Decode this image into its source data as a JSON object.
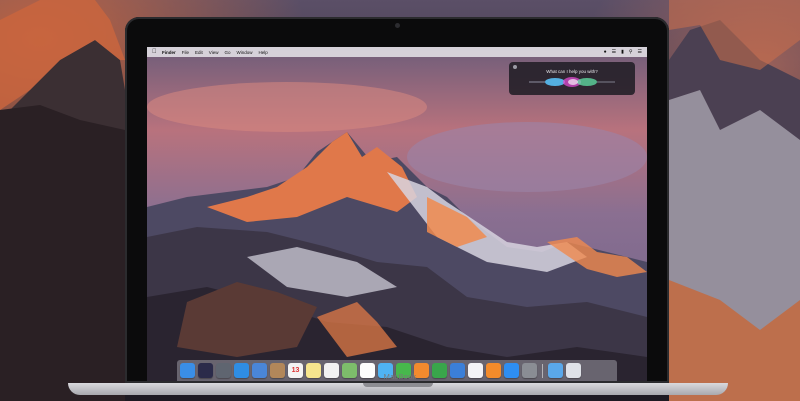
{
  "menubar": {
    "apple_icon": "apple-logo-icon",
    "items": [
      "Finder",
      "File",
      "Edit",
      "View",
      "Go",
      "Window",
      "Help"
    ],
    "status_icons": [
      "siri-icon",
      "wifi-icon",
      "battery-icon",
      "spotlight-icon",
      "notification-center-icon"
    ]
  },
  "siri": {
    "prompt": "What can I help you with?",
    "colors": {
      "blue": "#5bc8ff",
      "magenta": "#e04bd2",
      "green": "#61e3a6"
    }
  },
  "dock": {
    "apps": [
      {
        "name": "Finder",
        "icon": "finder-icon",
        "color": "#3a8ee6"
      },
      {
        "name": "Siri",
        "icon": "siri-icon",
        "color": "#2b2b4a"
      },
      {
        "name": "Launchpad",
        "icon": "launchpad-icon",
        "color": "#5f6570"
      },
      {
        "name": "Safari",
        "icon": "safari-icon",
        "color": "#2f8de4"
      },
      {
        "name": "Mail",
        "icon": "mail-icon",
        "color": "#4a86d8"
      },
      {
        "name": "Contacts",
        "icon": "contacts-icon",
        "color": "#b2875a"
      },
      {
        "name": "Calendar",
        "icon": "calendar-icon",
        "color": "#f4f4f4",
        "text": "13"
      },
      {
        "name": "Notes",
        "icon": "notes-icon",
        "color": "#f6e58d"
      },
      {
        "name": "Reminders",
        "icon": "reminders-icon",
        "color": "#f2f2f2"
      },
      {
        "name": "Maps",
        "icon": "maps-icon",
        "color": "#7dbd6b"
      },
      {
        "name": "Photos",
        "icon": "photos-icon",
        "color": "#fdfdfd"
      },
      {
        "name": "Messages",
        "icon": "messages-icon",
        "color": "#4fb3f2"
      },
      {
        "name": "FaceTime",
        "icon": "facetime-icon",
        "color": "#47b84c"
      },
      {
        "name": "Pages",
        "icon": "pages-icon",
        "color": "#f28a2e"
      },
      {
        "name": "Numbers",
        "icon": "numbers-icon",
        "color": "#39a64b"
      },
      {
        "name": "Keynote",
        "icon": "keynote-icon",
        "color": "#3b7fd8"
      },
      {
        "name": "iTunes",
        "icon": "itunes-icon",
        "color": "#f3f3f6"
      },
      {
        "name": "iBooks",
        "icon": "ibooks-icon",
        "color": "#f38b2b"
      },
      {
        "name": "App Store",
        "icon": "app-store-icon",
        "color": "#2e8ef2"
      },
      {
        "name": "System Preferences",
        "icon": "system-preferences-icon",
        "color": "#8a8d94"
      }
    ],
    "stack": [
      {
        "name": "Downloads",
        "icon": "folder-icon",
        "color": "#5aa8ea"
      },
      {
        "name": "Trash",
        "icon": "trash-icon",
        "color": "#dfe2e8"
      }
    ]
  },
  "device": {
    "brand": "MacBook"
  }
}
